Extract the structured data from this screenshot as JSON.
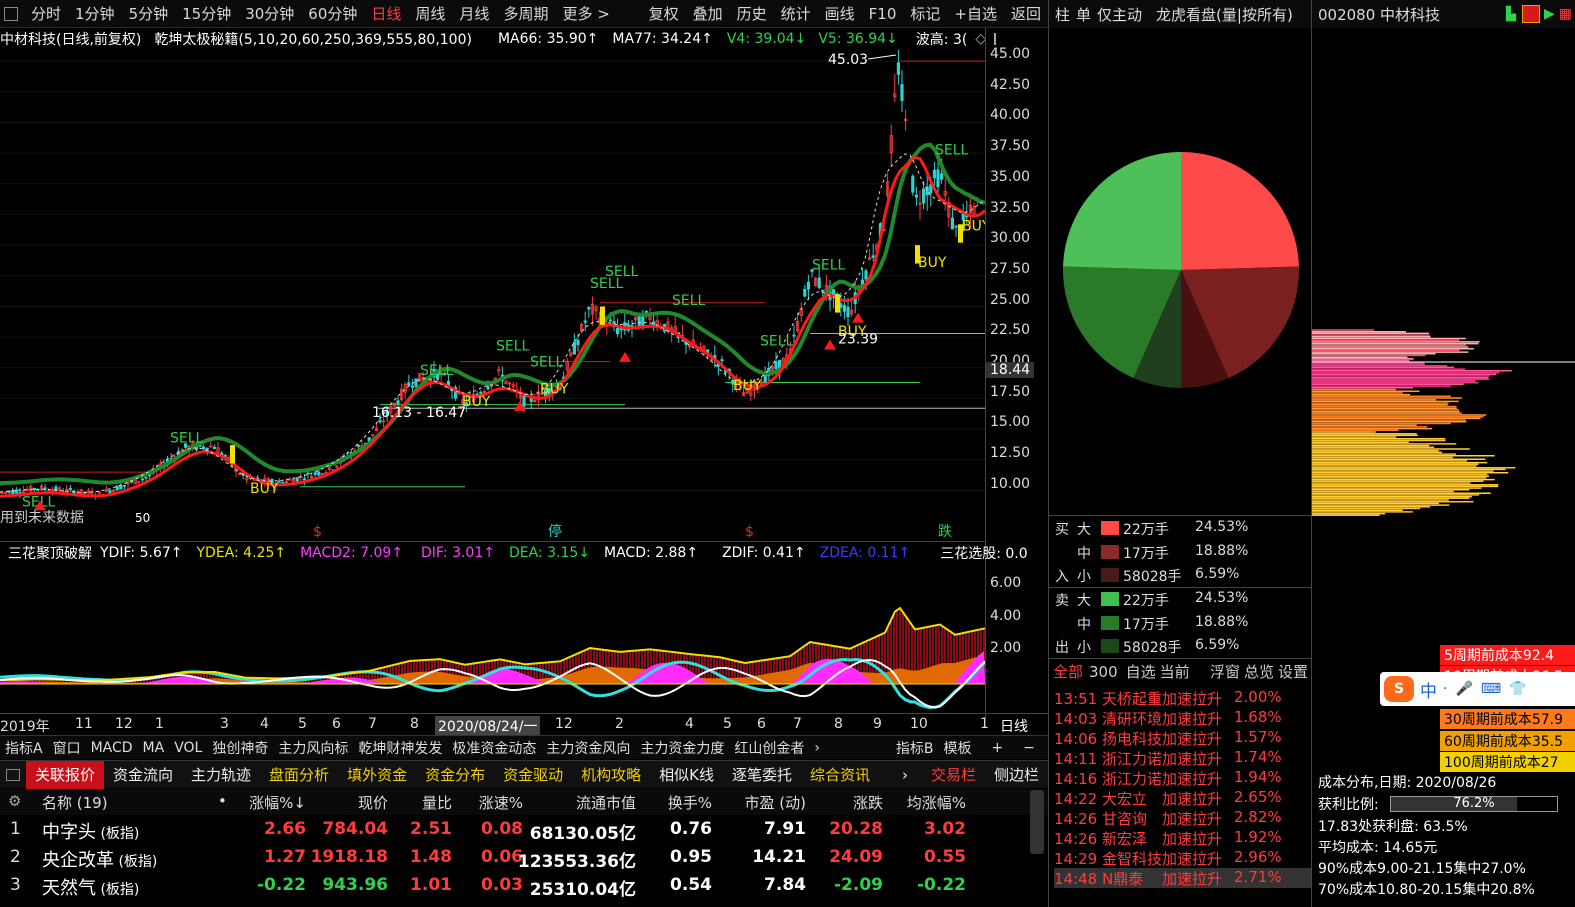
{
  "topbar": {
    "items": [
      "分时",
      "1分钟",
      "5分钟",
      "15分钟",
      "30分钟",
      "60分钟",
      "日线",
      "周线",
      "月线",
      "多周期",
      "更多 >"
    ],
    "active": "日线",
    "tools": [
      "复权",
      "叠加",
      "历史",
      "统计",
      "画线",
      "F10",
      "标记",
      "+自选",
      "返回"
    ]
  },
  "chart_info": {
    "stock": "中材科技(日线,前复权)",
    "indicator": "乾坤太极秘籍(5,10,20,60,250,369,555,80,100)",
    "ma66": "MA66: 35.90↑",
    "ma77": "MA77: 34.24↑",
    "v4": "V4: 39.04↓",
    "v5": "V5: 36.94↓",
    "wave": "波高: 3("
  },
  "price_axis": [
    "45.00",
    "42.50",
    "40.00",
    "37.50",
    "35.00",
    "32.50",
    "30.00",
    "27.50",
    "25.00",
    "22.50",
    "20.00",
    "17.50",
    "15.00",
    "12.50",
    "10.00"
  ],
  "current_price": "18.44",
  "chart_labels": {
    "high": "45.03",
    "low": "23.39",
    "range": "16.13 - 16.47",
    "sell": "SELL",
    "buy": "BUY",
    "future_note": "用到未来数据",
    "markers": [
      "$",
      "停",
      "$",
      "跌"
    ],
    "small_low": "50"
  },
  "ind_info": {
    "name": "三花聚顶破解",
    "ydif": "YDIF: 5.67↑",
    "ydea": "YDEA: 4.25↑",
    "macd2": "MACD2: 7.09↑",
    "dif": "DIF: 3.01↑",
    "dea": "DEA: 3.15↓",
    "macd": "MACD: 2.88↑",
    "zdif": "ZDIF: 0.41↑",
    "zdea": "ZDEA: 0.11↑",
    "sanhua": "三花选股: 0.0"
  },
  "ind_axis": [
    "6.00",
    "4.00",
    "2.00"
  ],
  "time_axis": [
    "2019年",
    "11",
    "12",
    "1",
    "3",
    "4",
    "5",
    "6",
    "7",
    "8",
    "2020/08/24/一",
    "12",
    "2",
    "4",
    "5",
    "6",
    "7",
    "8",
    "9",
    "10",
    "1"
  ],
  "period_label": "日线",
  "ind_tabs": [
    "指标A",
    "窗口",
    "MACD",
    "MA",
    "VOL",
    "独创神奇",
    "主力风向标",
    "乾坤财神发发",
    "极准资金动态",
    "主力资金风向",
    "主力资金力度",
    "红山创金者",
    "›"
  ],
  "ind_tabs_right": [
    "指标B",
    "模板",
    "+",
    "−"
  ],
  "bottom_tabs": [
    "关联报价",
    "资金流向",
    "主力轨迹",
    "盘面分析",
    "填外资金",
    "资金分布",
    "资金驱动",
    "机构攻略",
    "相似K线",
    "逐笔委托",
    "综合资讯",
    "›",
    "交易栏",
    "侧边栏"
  ],
  "table_head": [
    "名称 (19)",
    "涨幅%↓",
    "现价",
    "量比",
    "涨速%",
    "流通市值",
    "换手%",
    "市盈 (动)",
    "涨跌",
    "均涨幅%"
  ],
  "rows": [
    {
      "no": "1",
      "name": "中字头",
      "tag": "(板指)",
      "chg": "2.66",
      "price": "784.04",
      "vr": "2.51",
      "spd": "0.08",
      "cap": "68130.05亿",
      "turn": "0.76",
      "pe": "7.91",
      "diff": "20.28",
      "avg": "3.02",
      "up": true
    },
    {
      "no": "2",
      "name": "央企改革",
      "tag": "(板指)",
      "chg": "1.27",
      "price": "1918.18",
      "vr": "1.48",
      "spd": "0.06",
      "cap": "123553.36亿",
      "turn": "0.95",
      "pe": "14.21",
      "diff": "24.09",
      "avg": "0.55",
      "up": true
    },
    {
      "no": "3",
      "name": "天然气",
      "tag": "(板指)",
      "chg": "-0.22",
      "price": "943.96",
      "vr": "1.01",
      "spd": "0.03",
      "cap": "25310.04亿",
      "turn": "0.54",
      "pe": "7.84",
      "diff": "-2.09",
      "avg": "-0.22",
      "up": false
    }
  ],
  "rpanel_head": [
    "柱",
    "单",
    "仅主动",
    "龙虎看盘(量|按所有)"
  ],
  "flow": {
    "buy_label": [
      "买",
      "入"
    ],
    "sell_label": [
      "卖",
      "出"
    ],
    "buy": [
      {
        "size": "大",
        "vol": "22万手",
        "pct": "24.53%",
        "color": "#ff4a4a"
      },
      {
        "size": "中",
        "vol": "17万手",
        "pct": "18.88%",
        "color": "#8a2a2a"
      },
      {
        "size": "小",
        "vol": "58028手",
        "pct": "6.59%",
        "color": "#4a1a1a"
      }
    ],
    "sell": [
      {
        "size": "大",
        "vol": "22万手",
        "pct": "24.53%",
        "color": "#3fbf4f"
      },
      {
        "size": "中",
        "vol": "17万手",
        "pct": "18.88%",
        "color": "#2a7a2a"
      },
      {
        "size": "小",
        "vol": "58028手",
        "pct": "6.59%",
        "color": "#1a4a1a"
      }
    ]
  },
  "flow_tabs": [
    "全部",
    "300",
    "自选",
    "当前",
    "浮窗",
    "总览",
    "设置"
  ],
  "alerts": [
    {
      "time": "13:51",
      "name": "天桥起重",
      "type": "加速拉升",
      "pct": "2.00%"
    },
    {
      "time": "14:03",
      "name": "清研环境",
      "type": "加速拉升",
      "pct": "1.68%"
    },
    {
      "time": "14:06",
      "name": "扬电科技",
      "type": "加速拉升",
      "pct": "1.57%"
    },
    {
      "time": "14:11",
      "name": "浙江力诺",
      "type": "加速拉升",
      "pct": "1.74%"
    },
    {
      "time": "14:16",
      "name": "浙江力诺",
      "type": "加速拉升",
      "pct": "1.94%"
    },
    {
      "time": "14:22",
      "name": "大宏立",
      "type": "加速拉升",
      "pct": "2.65%"
    },
    {
      "time": "14:26",
      "name": "甘咨询",
      "type": "加速拉升",
      "pct": "2.82%"
    },
    {
      "time": "14:26",
      "name": "新宏泽",
      "type": "加速拉升",
      "pct": "1.92%"
    },
    {
      "time": "14:29",
      "name": "金智科技",
      "type": "加速拉升",
      "pct": "2.96%"
    },
    {
      "time": "14:48",
      "name": "N鼎泰",
      "type": "加速拉升",
      "pct": "2.71%"
    }
  ],
  "cpanel": {
    "title": "002080 中材科技",
    "costs": [
      "5周期前成本92.4",
      "10周期前成本86.5",
      "30周期前成本57.9",
      "60周期前成本35.5",
      "100周期前成本27"
    ],
    "ime": [
      "中",
      "·"
    ],
    "date": "成本分布,日期: 2020/08/26",
    "profit_label": "获利比例:",
    "profit": "76.2%",
    "profit_frac": 0.762,
    "line1": "17.83处获利盘: 63.5%",
    "line2": "平均成本: 14.65元",
    "line3": "90%成本9.00-21.15集中27.0%",
    "line4": "70%成本10.80-20.15集中20.8%"
  }
}
